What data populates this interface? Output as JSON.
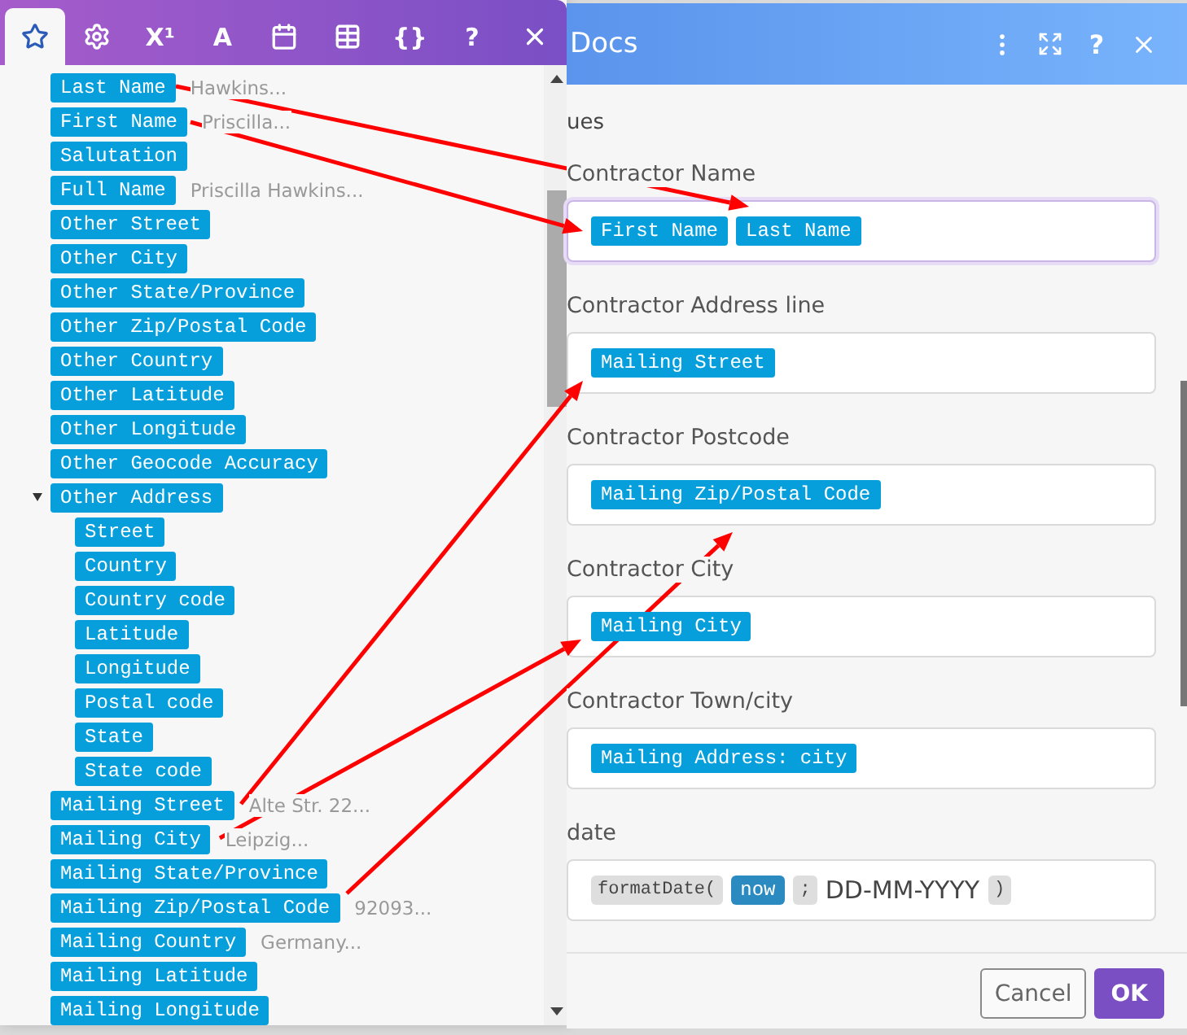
{
  "picker": {
    "tabs": [
      {
        "kind": "icon",
        "selected": true
      },
      {
        "kind": "icon",
        "selected": false
      },
      {
        "kind": "text",
        "label": "X¹",
        "selected": false
      },
      {
        "kind": "text",
        "label": "A",
        "selected": false
      },
      {
        "kind": "icon",
        "selected": false
      },
      {
        "kind": "icon",
        "selected": false
      },
      {
        "kind": "text",
        "label": "{}",
        "selected": false
      },
      {
        "kind": "text",
        "label": "?",
        "selected": false
      },
      {
        "kind": "icon",
        "selected": false
      }
    ],
    "items": [
      {
        "label": "Last Name",
        "hint": "Hawkins..."
      },
      {
        "label": "First Name",
        "hint": "Priscilla..."
      },
      {
        "label": "Salutation"
      },
      {
        "label": "Full Name",
        "hint": "Priscilla Hawkins..."
      },
      {
        "label": "Other Street"
      },
      {
        "label": "Other City"
      },
      {
        "label": "Other State/Province"
      },
      {
        "label": "Other Zip/Postal Code"
      },
      {
        "label": "Other Country"
      },
      {
        "label": "Other Latitude"
      },
      {
        "label": "Other Longitude"
      },
      {
        "label": "Other Geocode Accuracy"
      },
      {
        "label": "Other Address",
        "expanded": true,
        "children": [
          {
            "label": "Street"
          },
          {
            "label": "Country"
          },
          {
            "label": "Country code"
          },
          {
            "label": "Latitude"
          },
          {
            "label": "Longitude"
          },
          {
            "label": "Postal code"
          },
          {
            "label": "State"
          },
          {
            "label": "State code"
          }
        ]
      },
      {
        "label": "Mailing Street",
        "hint": "Alte Str. 22..."
      },
      {
        "label": "Mailing City",
        "hint": "Leipzig..."
      },
      {
        "label": "Mailing State/Province"
      },
      {
        "label": "Mailing Zip/Postal Code",
        "hint": "92093..."
      },
      {
        "label": "Mailing Country",
        "hint": "Germany..."
      },
      {
        "label": "Mailing Latitude"
      },
      {
        "label": "Mailing Longitude"
      }
    ]
  },
  "dialog": {
    "title": "Docs",
    "help": "?",
    "section": "ues",
    "fields": [
      {
        "label": "Contractor Name",
        "focused": true,
        "tokens": [
          {
            "kind": "var",
            "text": "First Name"
          },
          {
            "kind": "var",
            "text": "Last Name"
          }
        ]
      },
      {
        "label": "Contractor Address line",
        "focused": false,
        "tokens": [
          {
            "kind": "var",
            "text": "Mailing Street"
          }
        ]
      },
      {
        "label": "Contractor Postcode",
        "focused": false,
        "tokens": [
          {
            "kind": "var",
            "text": "Mailing Zip/Postal Code"
          }
        ]
      },
      {
        "label": "Contractor City",
        "focused": false,
        "tokens": [
          {
            "kind": "var",
            "text": "Mailing City"
          }
        ]
      },
      {
        "label": "Contractor Town/city",
        "focused": false,
        "tokens": [
          {
            "kind": "var",
            "text": "Mailing Address: city"
          }
        ]
      },
      {
        "label": "date",
        "focused": false,
        "tokens": [
          {
            "kind": "func",
            "text": "formatDate("
          },
          {
            "kind": "keyword",
            "text": "now"
          },
          {
            "kind": "func",
            "text": ";"
          },
          {
            "kind": "text",
            "text": "DD-MM-YYYY"
          },
          {
            "kind": "func",
            "text": ")"
          }
        ]
      }
    ],
    "buttons": [
      {
        "kind": "secondary",
        "label": "Cancel"
      },
      {
        "kind": "primary",
        "label": "OK"
      }
    ]
  }
}
